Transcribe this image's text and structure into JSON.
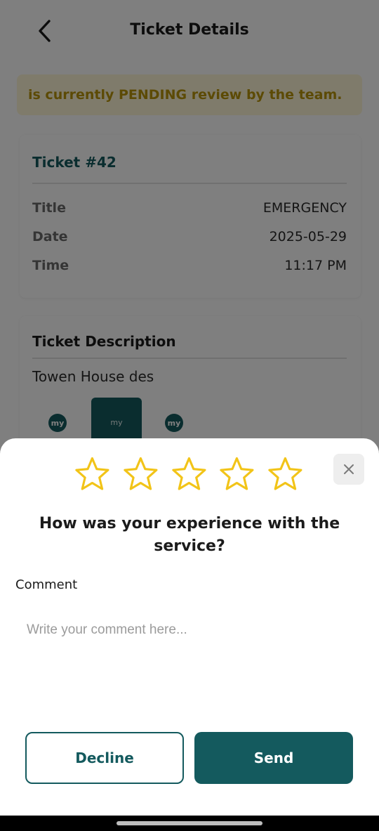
{
  "header": {
    "title": "Ticket Details"
  },
  "notice": {
    "text": "is currently PENDING review by the team."
  },
  "ticket": {
    "title": "Ticket #42",
    "rows": [
      {
        "label": "Title",
        "value": "EMERGENCY"
      },
      {
        "label": "Date",
        "value": "2025-05-29"
      },
      {
        "label": "Time",
        "value": "11:17 PM"
      }
    ]
  },
  "description": {
    "title": "Ticket Description",
    "text": "Towen House des",
    "attachments": [
      "my",
      "my",
      "my"
    ]
  },
  "rating": {
    "stars_total": 5,
    "stars_selected": 0,
    "star_color": "#f2c418",
    "question": "How was your experience with the service?",
    "comment_label": "Comment",
    "comment_placeholder": "Write your comment here...",
    "comment_value": "",
    "decline_label": "Decline",
    "send_label": "Send"
  },
  "colors": {
    "primary": "#145a5e",
    "notice_bg": "#fff7d6",
    "notice_text": "#b8950a"
  }
}
